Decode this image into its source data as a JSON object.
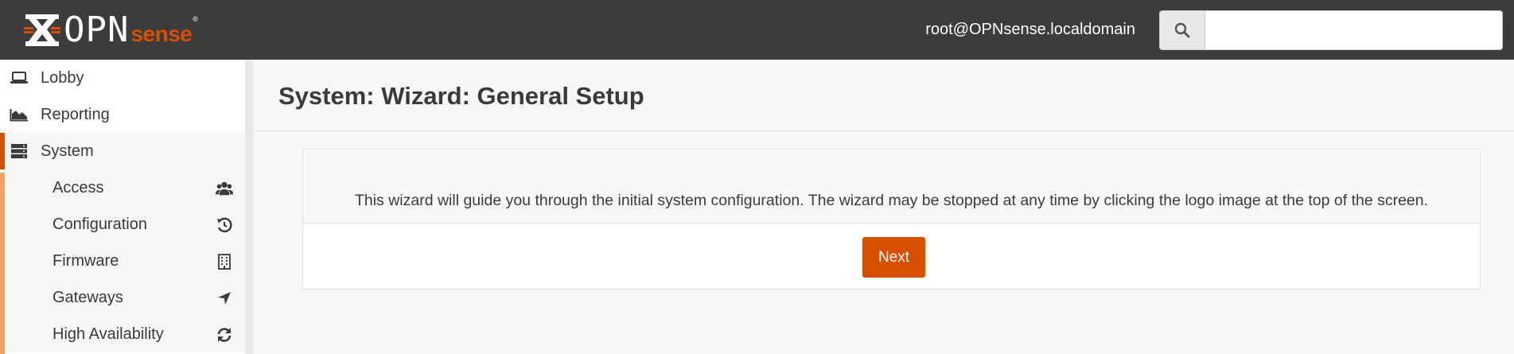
{
  "header": {
    "logo_text": "OPN",
    "logo_accent": "sense",
    "logo_mark": "®",
    "user": "root@OPNsense.localdomain",
    "search_icon": "search-icon",
    "search_value": ""
  },
  "sidebar": {
    "items": [
      {
        "label": "Lobby",
        "icon": "laptop-icon"
      },
      {
        "label": "Reporting",
        "icon": "area-chart-icon"
      },
      {
        "label": "System",
        "icon": "server-icon"
      }
    ],
    "subitems": [
      {
        "label": "Access",
        "icon": "users-icon"
      },
      {
        "label": "Configuration",
        "icon": "history-icon"
      },
      {
        "label": "Firmware",
        "icon": "building-icon"
      },
      {
        "label": "Gateways",
        "icon": "location-arrow-icon"
      },
      {
        "label": "High Availability",
        "icon": "refresh-icon"
      }
    ]
  },
  "main": {
    "title": "System: Wizard: General Setup",
    "description": "This wizard will guide you through the initial system configuration. The wizard may be stopped at any time by clicking the logo image at the top of the screen.",
    "next_label": "Next"
  },
  "colors": {
    "accent": "#d94f00",
    "header_bg": "#3c3c3c",
    "submenu_bar": "#f3a166"
  }
}
